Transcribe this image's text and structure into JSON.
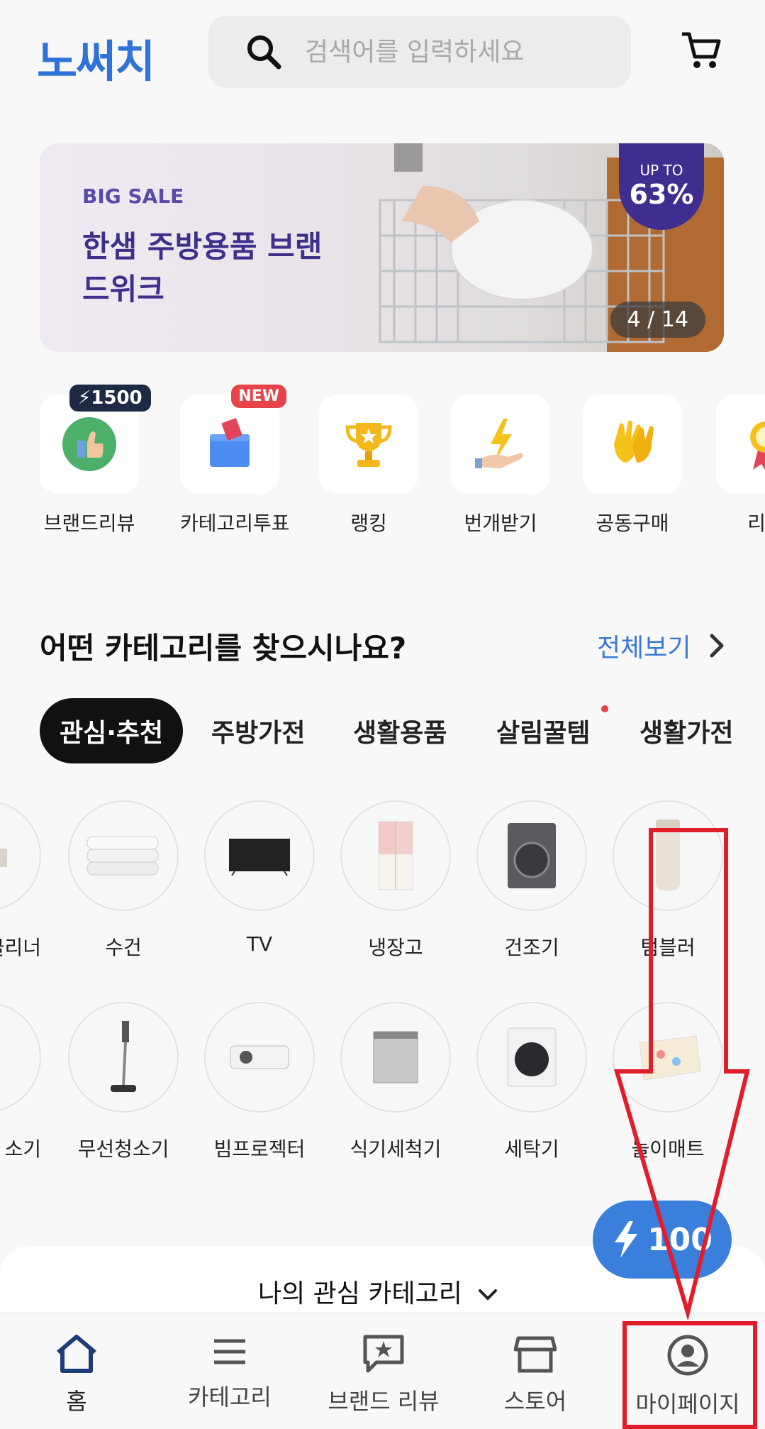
{
  "header": {
    "logo": "노써치",
    "search_placeholder": "검색어를 입력하세요",
    "search_icon": "search-icon",
    "cart_icon": "cart-icon"
  },
  "banner": {
    "small": "BIG SALE",
    "title": "한샘 주방용품 브랜드위크",
    "upto_label": "UP TO",
    "upto_value": "63%",
    "counter": "4 / 14"
  },
  "quick_menu": [
    {
      "label": "브랜드리뷰",
      "badge": "1500",
      "icon": "thumbs-up-icon"
    },
    {
      "label": "카테고리투표",
      "badge": "NEW",
      "icon": "ballot-box-icon"
    },
    {
      "label": "랭킹",
      "icon": "trophy-icon"
    },
    {
      "label": "번개받기",
      "icon": "lightning-hand-icon"
    },
    {
      "label": "공동구매",
      "icon": "hands-icon"
    },
    {
      "label": "리뷰",
      "icon": "medal-icon"
    }
  ],
  "section": {
    "title": "어떤 카테고리를 찾으시나요?",
    "see_all": "전체보기"
  },
  "chips": [
    "관심·추천",
    "주방가전",
    "생활용품",
    "살림꿀템",
    "생활가전"
  ],
  "categories_row1": [
    "클리너",
    "수건",
    "TV",
    "냉장고",
    "건조기",
    "텀블러"
  ],
  "categories_row2": [
    "소기",
    "무선청소기",
    "빔프로젝터",
    "식기세척기",
    "세탁기",
    "놀이매트"
  ],
  "fab": {
    "value": "100"
  },
  "interest": {
    "label": "나의 관심 카테고리"
  },
  "bottom_nav": [
    {
      "label": "홈",
      "icon": "home-icon"
    },
    {
      "label": "카테고리",
      "icon": "menu-icon"
    },
    {
      "label": "브랜드 리뷰",
      "icon": "review-star-icon"
    },
    {
      "label": "스토어",
      "icon": "store-icon"
    },
    {
      "label": "마이페이지",
      "icon": "profile-icon"
    }
  ],
  "colors": {
    "brand": "#2f73d9",
    "annotation": "#e21d2a",
    "fab": "#3b7fdc"
  }
}
